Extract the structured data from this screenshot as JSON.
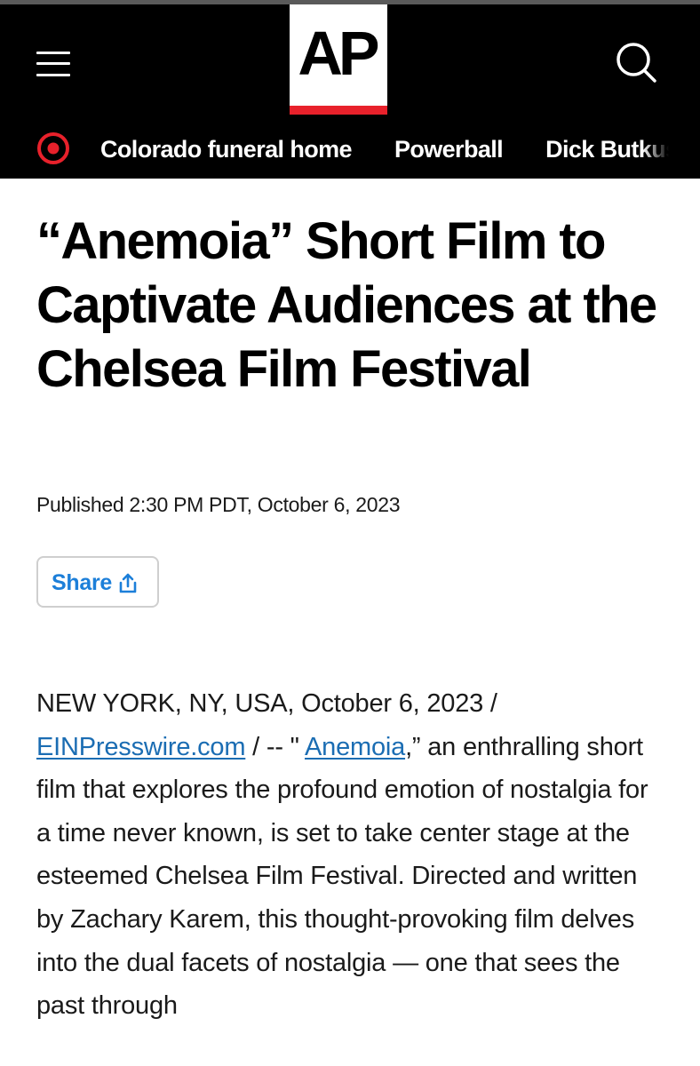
{
  "header": {
    "logo_text": "AP",
    "menu_icon": "hamburger-menu-icon",
    "search_icon": "search-icon",
    "trending_icon": "target-icon",
    "colors": {
      "background": "#000000",
      "logo_accent": "#e8212b",
      "trending_icon": "#e8212b"
    },
    "trending": [
      {
        "label": "Colorado funeral home"
      },
      {
        "label": "Powerball"
      },
      {
        "label": "Dick Butkus"
      }
    ]
  },
  "article": {
    "headline": "“Anemoia” Short Film to Captivate Audiences at the Chelsea Film Festival",
    "published": "Published 2:30 PM PDT, October 6, 2023",
    "share": {
      "label": "Share",
      "icon": "share-upload-icon",
      "color": "#1c7fd9"
    },
    "body": {
      "dateline": "NEW YORK, NY, USA, October 6, 2023 /",
      "source_link": "EINPresswire.com",
      "mid": " / -- \" ",
      "film_link": "Anemoia",
      "rest": ",” an enthralling short film that explores the profound emotion of nostalgia for a time never known, is set to take center stage at the esteemed Chelsea Film Festival. Directed and written by Zachary Karem, this thought-provoking film delves into the dual facets of nostalgia — one that sees the past through",
      "link_color": "#1b6db3"
    }
  }
}
